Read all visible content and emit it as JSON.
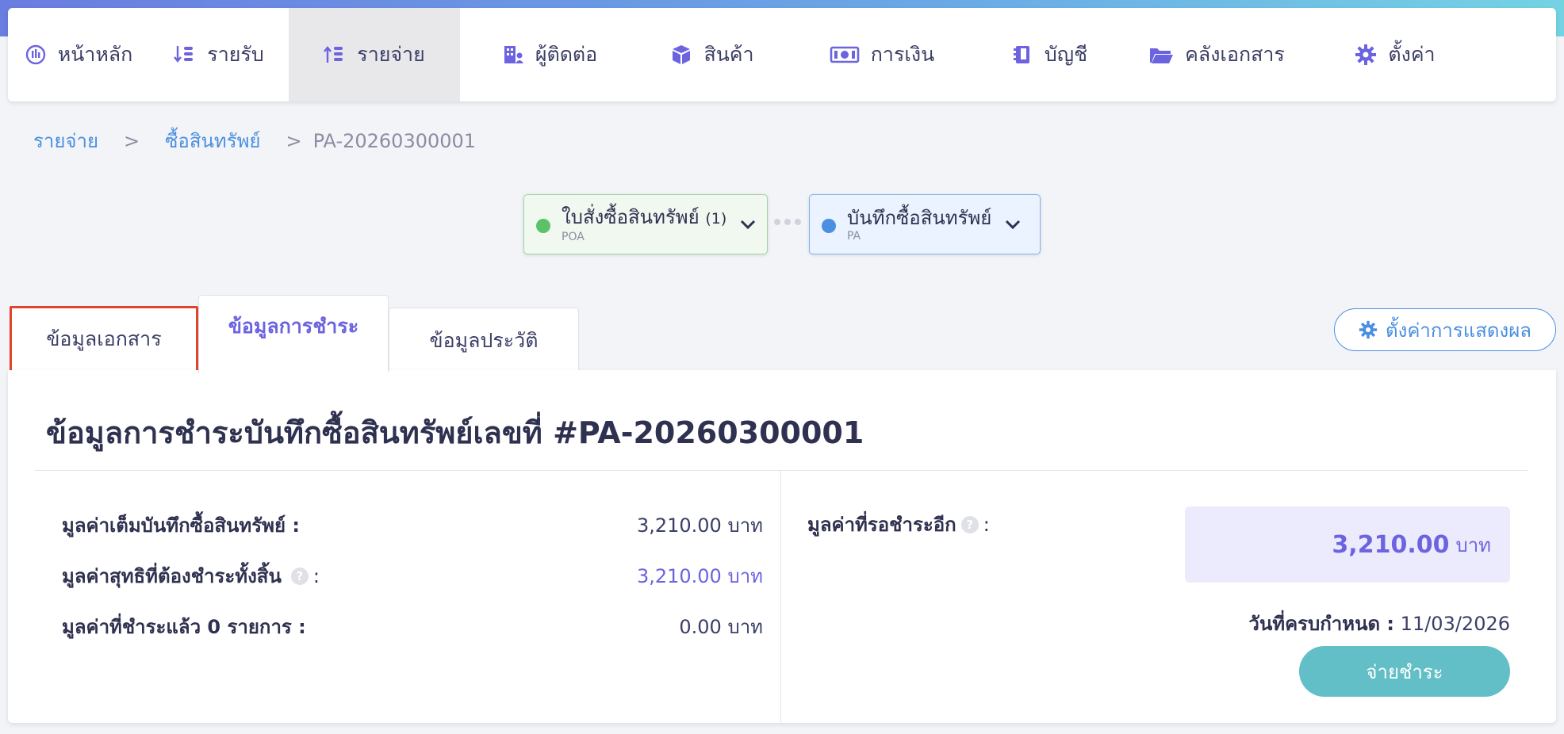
{
  "nav": {
    "items": [
      {
        "label": "หน้าหลัก",
        "icon": "dashboard-icon"
      },
      {
        "label": "รายรับ",
        "icon": "income-sort-icon"
      },
      {
        "label": "รายจ่าย",
        "icon": "expense-sort-icon",
        "active": true
      },
      {
        "label": "ผู้ติดต่อ",
        "icon": "building-contact-icon"
      },
      {
        "label": "สินค้า",
        "icon": "box-icon"
      },
      {
        "label": "การเงิน",
        "icon": "money-icon"
      },
      {
        "label": "บัญชี",
        "icon": "book-icon"
      },
      {
        "label": "คลังเอกสาร",
        "icon": "folder-icon"
      },
      {
        "label": "ตั้งค่า",
        "icon": "gear-icon"
      }
    ]
  },
  "breadcrumb": {
    "level1": "รายจ่าย",
    "level2": "ซื้อสินทรัพย์",
    "current": "PA-20260300001",
    "separator": ">"
  },
  "flow": {
    "poa": {
      "title": "ใบสั่งซื้อสินทรัพย์",
      "count": "(1)",
      "code": "POA",
      "dot_color": "#5cc26a"
    },
    "pa": {
      "title": "บันทึกซื้อสินทรัพย์",
      "code": "PA",
      "dot_color": "#4a8fe0"
    }
  },
  "tabs": {
    "document": "ข้อมูลเอกสาร",
    "payment": "ข้อมูลการชำระ",
    "history": "ข้อมูลประวัติ"
  },
  "display_settings_label": "ตั้งค่าการแสดงผล",
  "panel": {
    "title": "ข้อมูลการชำระบันทึกซื้อสินทรัพย์เลขที่ #PA-20260300001",
    "rows": [
      {
        "label": "มูลค่าเต็มบันทึกซื้อสินทรัพย์ :",
        "value": "3,210.00 บาท"
      },
      {
        "label": "มูลค่าสุทธิที่ต้องชำระทั้งสิ้น",
        "suffix": ":",
        "value": "3,210.00 บาท"
      },
      {
        "label": "มูลค่าที่ชำระแล้ว 0 รายการ :",
        "value": "0.00 บาท"
      }
    ],
    "remaining": {
      "label": "มูลค่าที่รอชำระอีก",
      "suffix": ":",
      "amount": "3,210.00",
      "unit": "บาท"
    },
    "due": {
      "label": "วันที่ครบกำหนด :",
      "date": "11/03/2026"
    },
    "pay_button": "จ่ายชำระ"
  },
  "colors": {
    "accent": "#6c63e0",
    "link": "#4a8fe0",
    "pay_button": "#62bfc7",
    "highlight_border": "#e0452c"
  }
}
